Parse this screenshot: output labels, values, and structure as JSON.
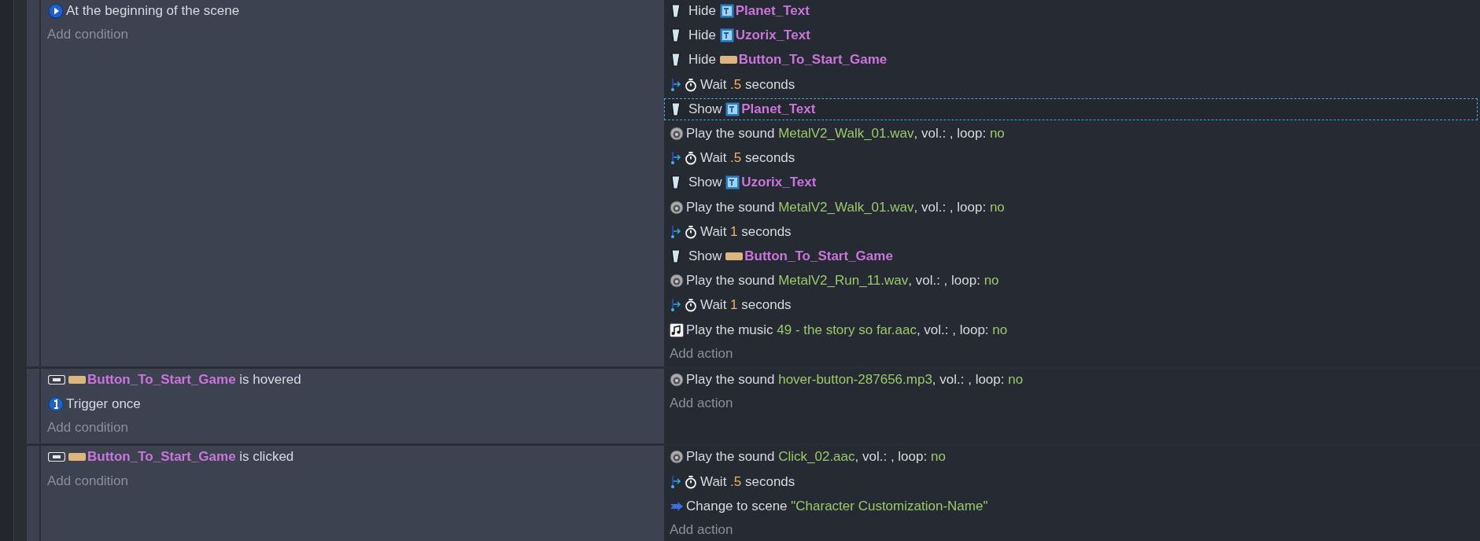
{
  "events": [
    {
      "conditions": [
        {
          "kind": "scene-start",
          "parts": [
            {
              "kind": "text",
              "text": "At the beginning of the scene"
            }
          ]
        }
      ],
      "add_condition": "Add condition",
      "actions": [
        {
          "kind": "visibility",
          "selected": false,
          "parts": [
            {
              "kind": "text",
              "text": "Hide "
            },
            {
              "kind": "text-object",
              "text": "Planet_Text"
            }
          ]
        },
        {
          "kind": "visibility",
          "selected": false,
          "parts": [
            {
              "kind": "text",
              "text": "Hide "
            },
            {
              "kind": "text-object",
              "text": "Uzorix_Text"
            }
          ]
        },
        {
          "kind": "visibility",
          "selected": false,
          "parts": [
            {
              "kind": "text",
              "text": "Hide "
            },
            {
              "kind": "button-object",
              "text": "Button_To_Start_Game"
            }
          ]
        },
        {
          "kind": "wait",
          "selected": false,
          "parts": [
            {
              "kind": "text",
              "text": "Wait "
            },
            {
              "kind": "number",
              "text": ".5"
            },
            {
              "kind": "text",
              "text": " seconds"
            }
          ]
        },
        {
          "kind": "visibility",
          "selected": true,
          "parts": [
            {
              "kind": "text",
              "text": "Show "
            },
            {
              "kind": "text-object",
              "text": "Planet_Text"
            }
          ]
        },
        {
          "kind": "sound",
          "selected": false,
          "parts": [
            {
              "kind": "text",
              "text": "Play the sound "
            },
            {
              "kind": "value",
              "text": "MetalV2_Walk_01.wav"
            },
            {
              "kind": "text",
              "text": ", vol.: , loop: "
            },
            {
              "kind": "value",
              "text": "no"
            }
          ]
        },
        {
          "kind": "wait",
          "selected": false,
          "parts": [
            {
              "kind": "text",
              "text": "Wait "
            },
            {
              "kind": "number",
              "text": ".5"
            },
            {
              "kind": "text",
              "text": " seconds"
            }
          ]
        },
        {
          "kind": "visibility",
          "selected": false,
          "parts": [
            {
              "kind": "text",
              "text": "Show "
            },
            {
              "kind": "text-object",
              "text": "Uzorix_Text"
            }
          ]
        },
        {
          "kind": "sound",
          "selected": false,
          "parts": [
            {
              "kind": "text",
              "text": "Play the sound "
            },
            {
              "kind": "value",
              "text": "MetalV2_Walk_01.wav"
            },
            {
              "kind": "text",
              "text": ", vol.: , loop: "
            },
            {
              "kind": "value",
              "text": "no"
            }
          ]
        },
        {
          "kind": "wait",
          "selected": false,
          "parts": [
            {
              "kind": "text",
              "text": "Wait "
            },
            {
              "kind": "number",
              "text": "1"
            },
            {
              "kind": "text",
              "text": " seconds"
            }
          ]
        },
        {
          "kind": "visibility",
          "selected": false,
          "parts": [
            {
              "kind": "text",
              "text": "Show "
            },
            {
              "kind": "button-object",
              "text": "Button_To_Start_Game"
            }
          ]
        },
        {
          "kind": "sound",
          "selected": false,
          "parts": [
            {
              "kind": "text",
              "text": "Play the sound "
            },
            {
              "kind": "value",
              "text": "MetalV2_Run_11.wav"
            },
            {
              "kind": "text",
              "text": ", vol.: , loop: "
            },
            {
              "kind": "value",
              "text": "no"
            }
          ]
        },
        {
          "kind": "wait",
          "selected": false,
          "parts": [
            {
              "kind": "text",
              "text": "Wait "
            },
            {
              "kind": "number",
              "text": "1"
            },
            {
              "kind": "text",
              "text": " seconds"
            }
          ]
        },
        {
          "kind": "music",
          "selected": false,
          "parts": [
            {
              "kind": "text",
              "text": "Play the music "
            },
            {
              "kind": "value",
              "text": "49 - the story so far.aac"
            },
            {
              "kind": "text",
              "text": ", vol.: , loop: "
            },
            {
              "kind": "value",
              "text": "no"
            }
          ]
        }
      ],
      "add_action": "Add action"
    },
    {
      "conditions": [
        {
          "kind": "button-event",
          "parts": [
            {
              "kind": "button-object",
              "text": "Button_To_Start_Game"
            },
            {
              "kind": "text",
              "text": " is hovered"
            }
          ]
        },
        {
          "kind": "trigger-once",
          "parts": [
            {
              "kind": "text",
              "text": "Trigger once"
            }
          ]
        }
      ],
      "add_condition": "Add condition",
      "actions": [
        {
          "kind": "sound",
          "selected": false,
          "parts": [
            {
              "kind": "text",
              "text": "Play the sound "
            },
            {
              "kind": "value",
              "text": "hover-button-287656.mp3"
            },
            {
              "kind": "text",
              "text": ", vol.: , loop: "
            },
            {
              "kind": "value",
              "text": "no"
            }
          ]
        }
      ],
      "add_action": "Add action"
    },
    {
      "conditions": [
        {
          "kind": "button-event",
          "parts": [
            {
              "kind": "button-object",
              "text": "Button_To_Start_Game"
            },
            {
              "kind": "text",
              "text": " is clicked"
            }
          ]
        }
      ],
      "add_condition": "Add condition",
      "actions": [
        {
          "kind": "sound",
          "selected": false,
          "parts": [
            {
              "kind": "text",
              "text": "Play the sound "
            },
            {
              "kind": "value",
              "text": "Click_02.aac"
            },
            {
              "kind": "text",
              "text": ", vol.: , loop: "
            },
            {
              "kind": "value",
              "text": "no"
            }
          ]
        },
        {
          "kind": "wait",
          "selected": false,
          "parts": [
            {
              "kind": "text",
              "text": "Wait "
            },
            {
              "kind": "number",
              "text": ".5"
            },
            {
              "kind": "text",
              "text": " seconds"
            }
          ]
        },
        {
          "kind": "scene",
          "selected": false,
          "parts": [
            {
              "kind": "text",
              "text": "Change to scene "
            },
            {
              "kind": "value",
              "text": "\"Character Customization-Name\""
            }
          ]
        }
      ],
      "add_action": "Add action"
    }
  ]
}
